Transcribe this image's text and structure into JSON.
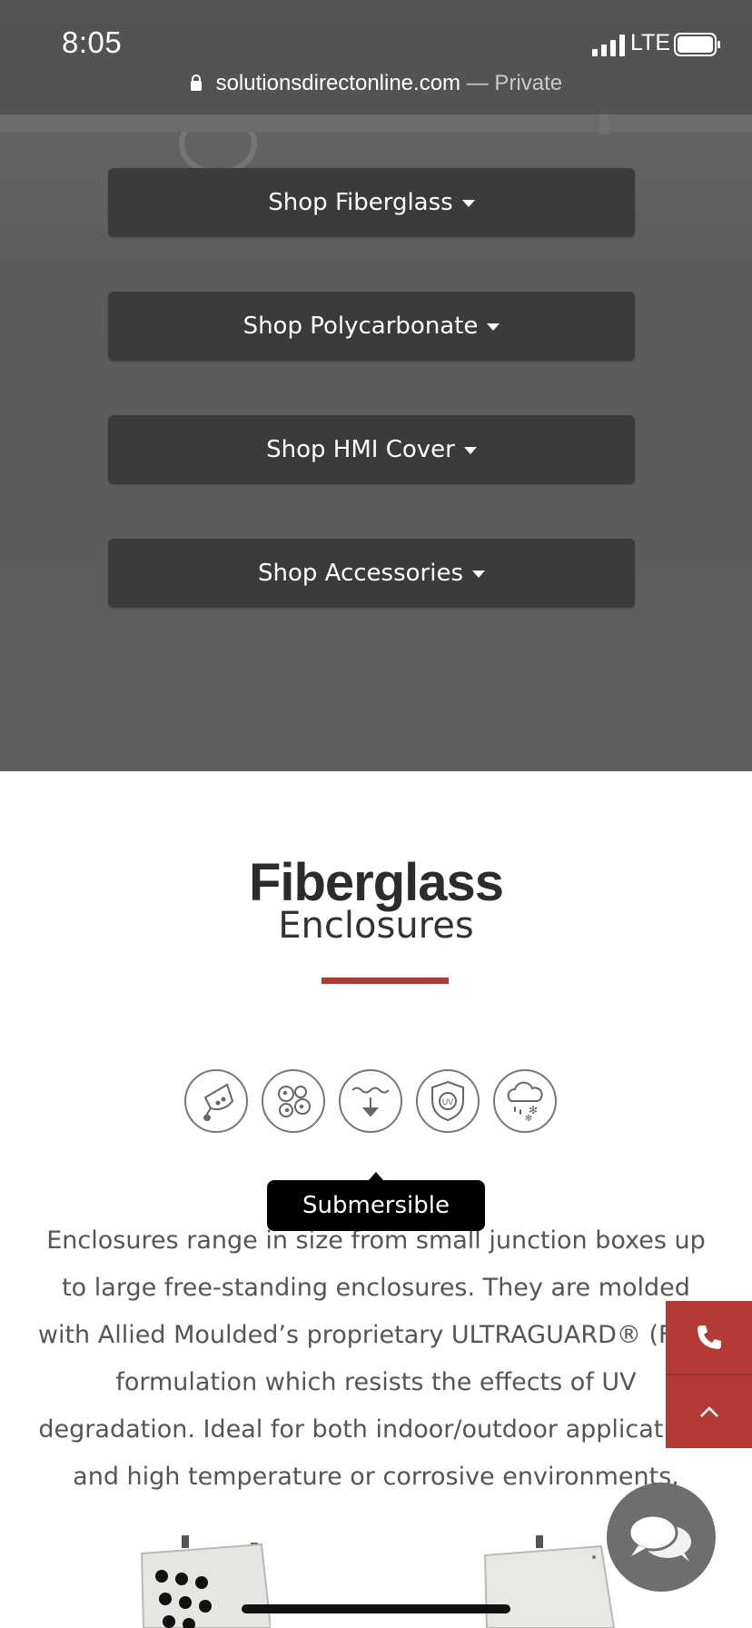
{
  "status_bar": {
    "time": "8:05",
    "network": "LTE",
    "url": "solutionsdirectonline.com",
    "private_label": "— Private"
  },
  "shop_menu": [
    {
      "label": "Shop Fiberglass"
    },
    {
      "label": "Shop Polycarbonate"
    },
    {
      "label": "Shop HMI Cover"
    },
    {
      "label": "Shop Accessories"
    }
  ],
  "section": {
    "title": "Fiberglass",
    "subtitle": "Enclosures",
    "accent_color": "#b33a35"
  },
  "feature_icons": [
    "chemical-resistant-icon",
    "dust-tight-icon",
    "submersible-icon",
    "uv-resistant-icon",
    "weather-resistant-icon"
  ],
  "tooltip": "Submersible",
  "description": "Enclosures range in size from small junction boxes up to large free-standing enclosures. They are molded with Allied Moulded’s proprietary ULTRAGUARD® (FRP) formulation which resists the effects of UV degradation. Ideal for both indoor/outdoor applications and high temperature or corrosive environments.",
  "floating_actions": [
    "phone-icon",
    "chevron-up-icon",
    "chat-icon"
  ]
}
